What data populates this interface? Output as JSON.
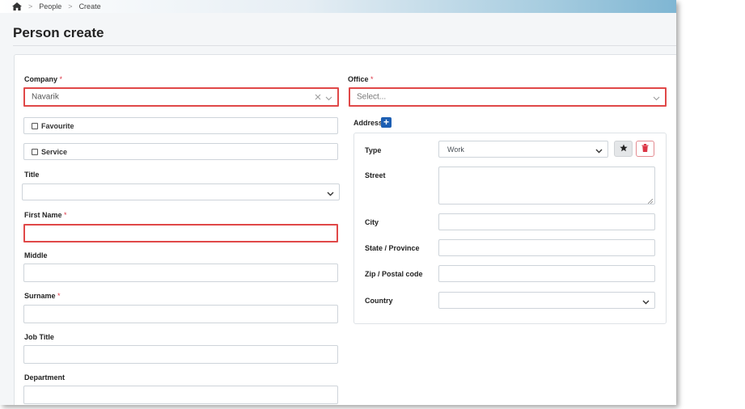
{
  "breadcrumb": {
    "items": [
      "People",
      "Create"
    ]
  },
  "page": {
    "title": "Person create"
  },
  "form": {
    "company": {
      "label": "Company",
      "required_mark": "*",
      "value": "Navarik"
    },
    "office": {
      "label": "Office",
      "required_mark": "*",
      "placeholder": "Select..."
    },
    "favourite": {
      "label": "Favourite",
      "checked": false
    },
    "service": {
      "label": "Service",
      "checked": false
    },
    "title": {
      "label": "Title",
      "value": ""
    },
    "first_name": {
      "label": "First Name",
      "required_mark": "*",
      "value": ""
    },
    "middle": {
      "label": "Middle",
      "value": ""
    },
    "surname": {
      "label": "Surname",
      "required_mark": "*",
      "value": ""
    },
    "job_title": {
      "label": "Job Title",
      "value": ""
    },
    "department": {
      "label": "Department",
      "value": ""
    }
  },
  "address": {
    "label": "Address",
    "add_label": "+",
    "type": {
      "label": "Type",
      "value": "Work"
    },
    "street": {
      "label": "Street",
      "value": ""
    },
    "city": {
      "label": "City",
      "value": ""
    },
    "state": {
      "label": "State / Province",
      "value": ""
    },
    "zip": {
      "label": "Zip / Postal code",
      "value": ""
    },
    "country": {
      "label": "Country",
      "value": ""
    }
  },
  "colors": {
    "accent": "#1d5fb3",
    "invalid_border": "#e04848",
    "required": "#dc3545",
    "delete": "#dc3545"
  },
  "icons": [
    "home-icon",
    "clear-icon",
    "chevron-down-icon",
    "plus-icon",
    "star-icon",
    "trash-icon",
    "resize-handle-icon"
  ]
}
